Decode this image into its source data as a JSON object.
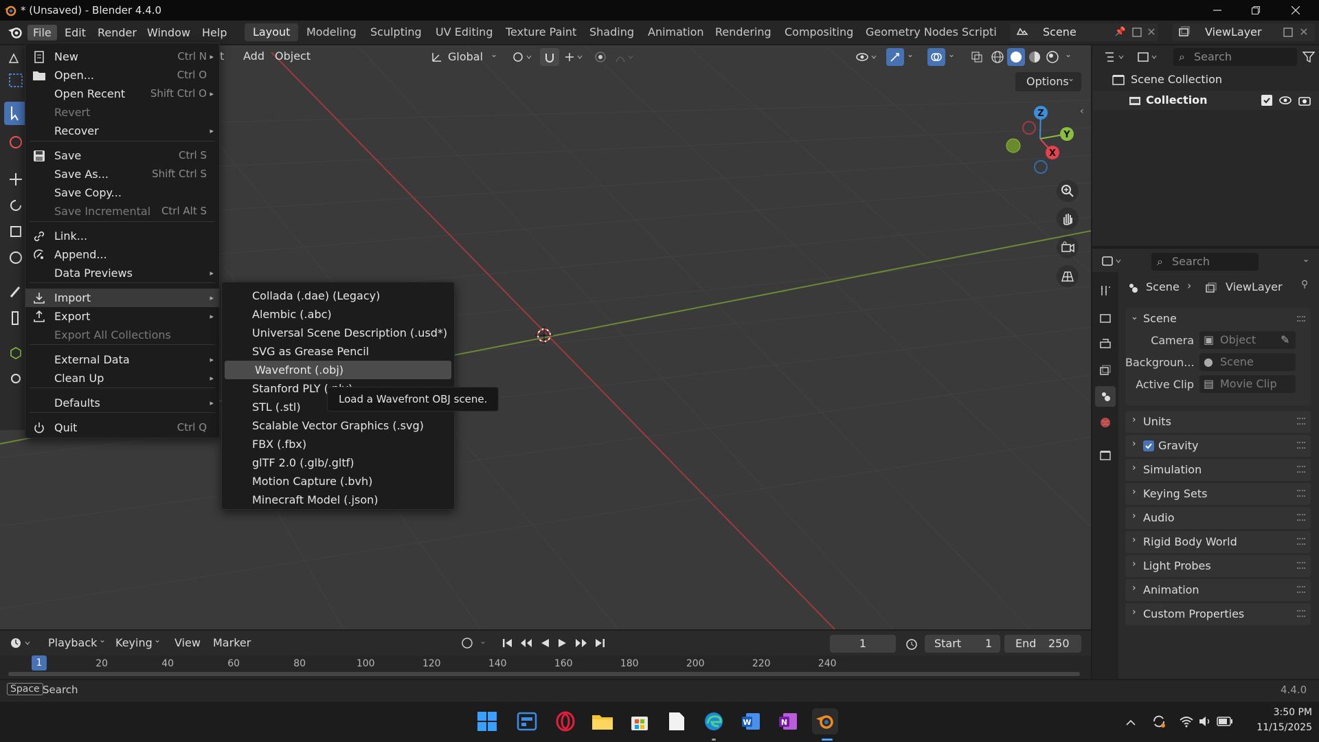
{
  "window": {
    "title": "* (Unsaved) - Blender 4.4.0"
  },
  "menubar": {
    "items": [
      "File",
      "Edit",
      "Render",
      "Window",
      "Help"
    ]
  },
  "workspaces": [
    "Layout",
    "Modeling",
    "Sculpting",
    "UV Editing",
    "Texture Paint",
    "Shading",
    "Animation",
    "Rendering",
    "Compositing",
    "Geometry Nodes",
    "Scripti"
  ],
  "scene": {
    "name": "Scene",
    "viewlayer": "ViewLayer"
  },
  "viewport": {
    "header": {
      "partial": "t",
      "add": "Add",
      "object": "Object",
      "orientation": "Global",
      "options": "Options"
    }
  },
  "outliner": {
    "search_placeholder": "Search",
    "scene_collection": "Scene Collection",
    "collection": "Collection"
  },
  "properties": {
    "search_placeholder": "Search",
    "breadcrumb_scene": "Scene",
    "breadcrumb_viewlayer": "ViewLayer",
    "panel_scene": "Scene",
    "camera_label": "Camera",
    "camera_value": "Object",
    "background_label": "Backgroun...",
    "background_value": "Scene",
    "clip_label": "Active Clip",
    "clip_value": "Movie Clip",
    "panels": [
      "Units",
      "Gravity",
      "Simulation",
      "Keying Sets",
      "Audio",
      "Rigid Body World",
      "Light Probes",
      "Animation",
      "Custom Properties"
    ]
  },
  "file_menu": {
    "items": [
      {
        "label": "New",
        "shortcut": "Ctrl N",
        "arrow": true
      },
      {
        "label": "Open...",
        "shortcut": "Ctrl O"
      },
      {
        "label": "Open Recent",
        "shortcut": "Shift Ctrl O",
        "arrow": true
      },
      {
        "label": "Revert",
        "disabled": true
      },
      {
        "label": "Recover",
        "arrow": true
      },
      {
        "label": "Save",
        "shortcut": "Ctrl S"
      },
      {
        "label": "Save As...",
        "shortcut": "Shift Ctrl S"
      },
      {
        "label": "Save Copy..."
      },
      {
        "label": "Save Incremental",
        "shortcut": "Ctrl Alt S",
        "disabled": true
      },
      {
        "label": "Link..."
      },
      {
        "label": "Append..."
      },
      {
        "label": "Data Previews",
        "arrow": true
      },
      {
        "label": "Import",
        "arrow": true
      },
      {
        "label": "Export",
        "arrow": true
      },
      {
        "label": "Export All Collections",
        "disabled": true
      },
      {
        "label": "External Data",
        "arrow": true
      },
      {
        "label": "Clean Up",
        "arrow": true
      },
      {
        "label": "Defaults",
        "arrow": true
      },
      {
        "label": "Quit",
        "shortcut": "Ctrl Q"
      }
    ]
  },
  "import_menu": {
    "items": [
      "Collada (.dae) (Legacy)",
      "Alembic (.abc)",
      "Universal Scene Description (.usd*)",
      "SVG as Grease Pencil",
      "Wavefront (.obj)",
      "Stanford PLY (.ply)",
      "STL (.stl)",
      "Scalable Vector Graphics (.svg)",
      "FBX (.fbx)",
      "glTF 2.0 (.glb/.gltf)",
      "Motion Capture (.bvh)",
      "Minecraft Model (.json)"
    ],
    "highlighted": "Wavefront (.obj)"
  },
  "tooltip": "Load a Wavefront OBJ scene.",
  "timeline": {
    "playback": "Playback",
    "keying": "Keying",
    "view": "View",
    "marker": "Marker",
    "current_frame": "1",
    "start_label": "Start",
    "start": "1",
    "end_label": "End",
    "end": "250",
    "ticks": [
      "1",
      "20",
      "40",
      "60",
      "80",
      "100",
      "120",
      "140",
      "160",
      "180",
      "200",
      "220",
      "240"
    ]
  },
  "statusbar": {
    "key": "Space",
    "action": "Search",
    "version": "4.4.0"
  },
  "taskbar": {
    "time": "3:50 PM",
    "date": "11/15/2025"
  },
  "colors": {
    "accent": "#4772b3",
    "x_axis": "#e5424f",
    "y_axis": "#8cbd3f",
    "z_axis": "#3b90dc"
  }
}
